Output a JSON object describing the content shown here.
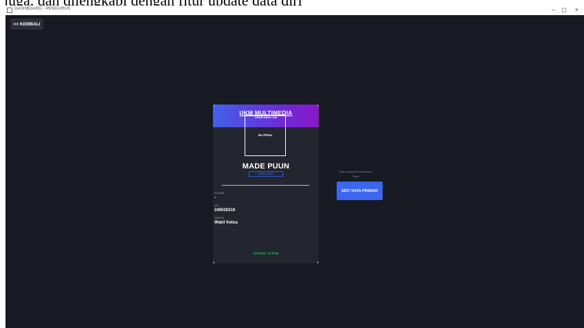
{
  "top_caption": "juga, dan dilengkapi dengan fitur update data diri",
  "window": {
    "title": "DASHBOARD - PENGURUS",
    "minimize_glyph": "–",
    "maximize_glyph": "◻",
    "close_glyph": "×"
  },
  "toolbar": {
    "back_label": "<< KEMBALI"
  },
  "card": {
    "org_name": "UKM MULTIMEDIA",
    "subtitle": "Official Admin Card",
    "photo_placeholder": "No Photo",
    "member_name": "MADE PUUN",
    "role": "PENGURUS",
    "fields": [
      {
        "label": "ID ADMIN",
        "value": "-"
      },
      {
        "label": "NIM",
        "value": "240030219"
      },
      {
        "label": "JABATAN",
        "value": "Wakil Ketua"
      }
    ],
    "status": "STATUS: ACTIVE"
  },
  "side": {
    "hint": "Ingin mengubah Password / Foto?",
    "edit_button": "EDIT DATA PRIBADI"
  },
  "colors": {
    "app_background": "#171a22",
    "card_background": "#23262f",
    "header_gradient_start": "#4361e8",
    "header_gradient_end": "#8a18c7",
    "accent_blue": "#3b66ee",
    "status_green": "#22c55e"
  }
}
